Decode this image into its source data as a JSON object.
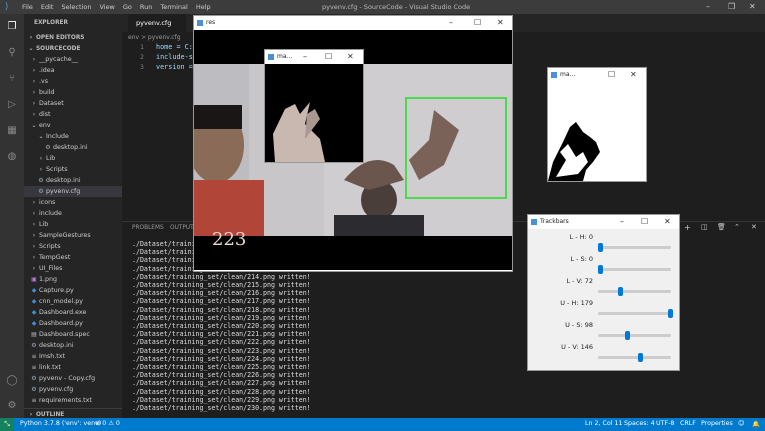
{
  "titlebar": {
    "menu": [
      "File",
      "Edit",
      "Selection",
      "View",
      "Go",
      "Run",
      "Terminal",
      "Help"
    ],
    "title": "pyvenv.cfg - SourceCode - Visual Studio Code"
  },
  "sidebar": {
    "explorer_label": "EXPLORER",
    "open_editors": "OPEN EDITORS",
    "root": "SOURCECODE",
    "items": [
      {
        "label": "__pycache__",
        "icon": "chevron-right",
        "indent": 1
      },
      {
        "label": ".idea",
        "icon": "chevron-right",
        "indent": 1
      },
      {
        "label": ".vs",
        "icon": "chevron-right",
        "indent": 1
      },
      {
        "label": "build",
        "icon": "chevron-right",
        "indent": 1
      },
      {
        "label": "Dataset",
        "icon": "chevron-right",
        "indent": 1
      },
      {
        "label": "dist",
        "icon": "chevron-right",
        "indent": 1
      },
      {
        "label": "env",
        "icon": "chevron-down",
        "indent": 1
      },
      {
        "label": "Include",
        "icon": "chevron-down",
        "indent": 2
      },
      {
        "label": "desktop.ini",
        "icon": "gear",
        "indent": 3
      },
      {
        "label": "Lib",
        "icon": "chevron-right",
        "indent": 2
      },
      {
        "label": "Scripts",
        "icon": "chevron-right",
        "indent": 2
      },
      {
        "label": "desktop.ini",
        "icon": "gear",
        "indent": 2
      },
      {
        "label": "pyvenv.cfg",
        "icon": "gear",
        "indent": 2,
        "selected": true
      },
      {
        "label": "icons",
        "icon": "chevron-right",
        "indent": 1
      },
      {
        "label": "include",
        "icon": "chevron-right",
        "indent": 1
      },
      {
        "label": "Lib",
        "icon": "chevron-right",
        "indent": 1
      },
      {
        "label": "SampleGestures",
        "icon": "chevron-right",
        "indent": 1
      },
      {
        "label": "Scripts",
        "icon": "chevron-right",
        "indent": 1
      },
      {
        "label": "TempGest",
        "icon": "chevron-right",
        "indent": 1
      },
      {
        "label": "UI_Files",
        "icon": "chevron-right",
        "indent": 1
      },
      {
        "label": "1.png",
        "icon": "image",
        "indent": 1
      },
      {
        "label": "Capture.py",
        "icon": "python",
        "indent": 1
      },
      {
        "label": "cnn_model.py",
        "icon": "python",
        "indent": 1
      },
      {
        "label": "Dashboard.exe",
        "icon": "exe",
        "indent": 1
      },
      {
        "label": "Dashboard.py",
        "icon": "python",
        "indent": 1
      },
      {
        "label": "Dashboard.spec",
        "icon": "file",
        "indent": 1
      },
      {
        "label": "desktop.ini",
        "icon": "gear",
        "indent": 1
      },
      {
        "label": "Imsh.txt",
        "icon": "text",
        "indent": 1
      },
      {
        "label": "link.txt",
        "icon": "text",
        "indent": 1
      },
      {
        "label": "pyvenv - Copy.cfg",
        "icon": "gear",
        "indent": 1
      },
      {
        "label": "pyvenv.cfg",
        "icon": "gear",
        "indent": 1
      },
      {
        "label": "requirements.txt",
        "icon": "text",
        "indent": 1
      }
    ],
    "outline": "OUTLINE",
    "timeline": "TIMELINE"
  },
  "editor": {
    "tab": "pyvenv.cfg",
    "breadcrumb": "env > pyvenv.cfg",
    "lines": [
      "home = C:\\",
      "include-sy",
      "version ="
    ],
    "line_numbers": [
      "1",
      "2",
      "3"
    ]
  },
  "panel": {
    "tabs": [
      "PROBLEMS",
      "OUTPUT"
    ],
    "terminal_prefix": "./Dataset/training",
    "lines": [
      "./Dataset/training",
      "./Dataset/training",
      "./Dataset/training",
      "./Dataset/training",
      "./Dataset/training_set/clean/214.png written!",
      "./Dataset/training_set/clean/215.png written!",
      "./Dataset/training_set/clean/216.png written!",
      "./Dataset/training_set/clean/217.png written!",
      "./Dataset/training_set/clean/218.png written!",
      "./Dataset/training_set/clean/219.png written!",
      "./Dataset/training_set/clean/220.png written!",
      "./Dataset/training_set/clean/221.png written!",
      "./Dataset/training_set/clean/222.png written!",
      "./Dataset/training_set/clean/223.png written!",
      "./Dataset/training_set/clean/224.png written!",
      "./Dataset/training_set/clean/225.png written!",
      "./Dataset/training_set/clean/226.png written!",
      "./Dataset/training_set/clean/227.png written!",
      "./Dataset/training_set/clean/228.png written!",
      "./Dataset/training_set/clean/229.png written!",
      "./Dataset/training_set/clean/230.png written!"
    ],
    "written_line_0": "./Dataset/training_set/clean/213.png written!"
  },
  "status": {
    "python": "Python 3.7.8 ('env': venv)",
    "problems": "⊗ 0 ⚠ 0",
    "position": "Ln 2, Col 11",
    "spaces": "Spaces: 4",
    "encoding": "UTF-8",
    "eol": "CRLF",
    "language": "Properties"
  },
  "windows": {
    "camera_title": "res",
    "mask_small_title": "ma...",
    "mask_title": "ma...",
    "trackbars_title": "Trackbars",
    "overlay_text": "223"
  },
  "trackbars": [
    {
      "label": "L - H: 0",
      "value": 0,
      "max": 179
    },
    {
      "label": "L - S: 0",
      "value": 0,
      "max": 255
    },
    {
      "label": "L - V: 72",
      "value": 72,
      "max": 255
    },
    {
      "label": "U - H: 179",
      "value": 179,
      "max": 179
    },
    {
      "label": "U - S: 98",
      "value": 98,
      "max": 255
    },
    {
      "label": "U - V: 146",
      "value": 146,
      "max": 255
    }
  ],
  "colors": {
    "accent": "#007acc",
    "roi_box": "#22dd22",
    "thumb": "#0078d7"
  }
}
